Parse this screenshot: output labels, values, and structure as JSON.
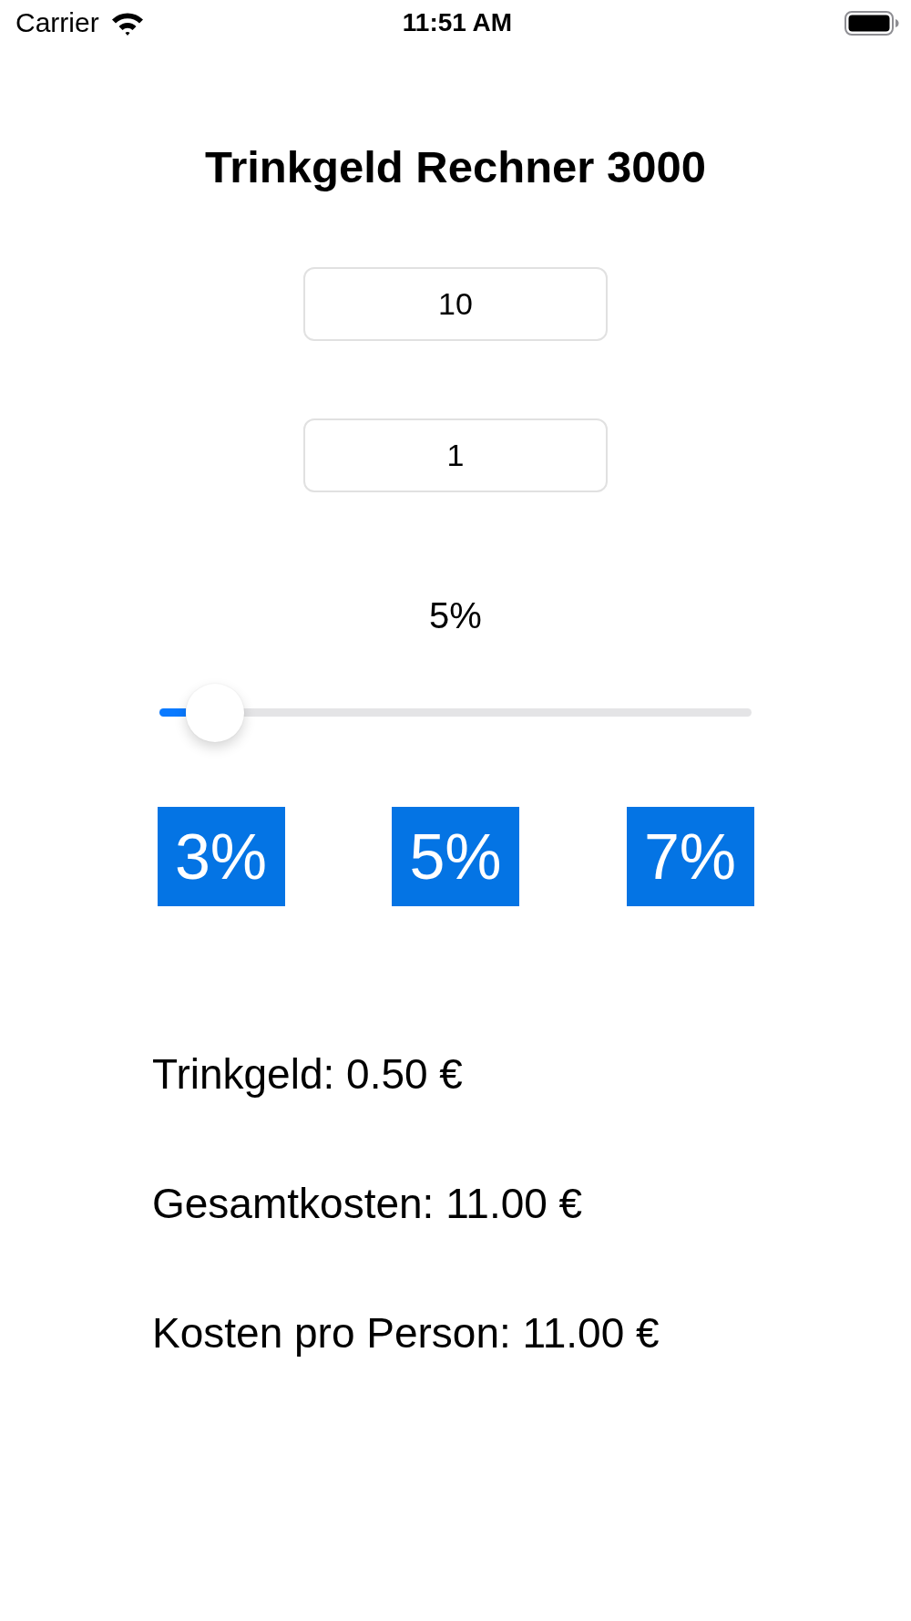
{
  "status_bar": {
    "carrier": "Carrier",
    "time": "11:51 AM"
  },
  "title": "Trinkgeld Rechner 3000",
  "fields": [
    {
      "value": "10"
    },
    {
      "value": "1"
    }
  ],
  "tip_slider": {
    "reading": "5%",
    "level": 0.05
  },
  "preset_buttons": [
    {
      "label": "3%"
    },
    {
      "label": "5%"
    },
    {
      "label": "7%"
    }
  ],
  "results": [
    "Trinkgeld: 0.50 €",
    "Gesamtkosten: 11.00 €",
    "Kosten pro Person: 11.00 €"
  ]
}
